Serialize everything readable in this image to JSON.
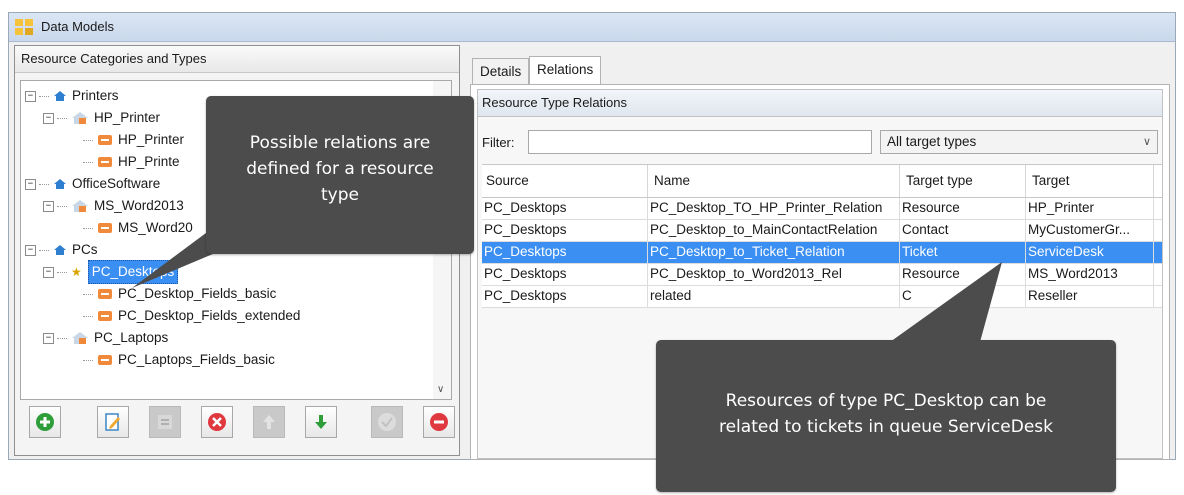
{
  "window": {
    "title": "Data Models"
  },
  "left_panel": {
    "title": "Resource Categories and Types",
    "tree": [
      {
        "label": "Printers"
      },
      {
        "label": "HP_Printer"
      },
      {
        "label": "HP_Printer"
      },
      {
        "label": "HP_Printe"
      },
      {
        "label": "OfficeSoftware"
      },
      {
        "label": "MS_Word2013"
      },
      {
        "label": "MS_Word20"
      },
      {
        "label": "PCs"
      },
      {
        "label": "PC_Desktops"
      },
      {
        "label": "PC_Desktop_Fields_basic"
      },
      {
        "label": "PC_Desktop_Fields_extended"
      },
      {
        "label": "PC_Laptops"
      },
      {
        "label": "PC_Laptops_Fields_basic"
      }
    ],
    "toolbar_icons": [
      "add-icon",
      "edit-icon",
      "edit-disabled-icon",
      "delete-icon",
      "move-up-icon",
      "move-down-icon",
      "confirm-icon",
      "remove-icon"
    ]
  },
  "right_panel": {
    "tabs": [
      "Details",
      "Relations"
    ],
    "active_tab": "Relations",
    "group_title": "Resource Type Relations",
    "filter_label": "Filter:",
    "filter_value": "",
    "target_filter": "All target types",
    "columns": [
      "Source",
      "Name",
      "Target type",
      "Target"
    ],
    "rows": [
      [
        "PC_Desktops",
        "PC_Desktop_TO_HP_Printer_Relation",
        "Resource",
        "HP_Printer"
      ],
      [
        "PC_Desktops",
        "PC_Desktop_to_MainContactRelation",
        "Contact",
        "MyCustomerGr..."
      ],
      [
        "PC_Desktops",
        "PC_Desktop_to_Ticket_Relation",
        "Ticket",
        "ServiceDesk"
      ],
      [
        "PC_Desktops",
        "PC_Desktop_to_Word2013_Rel",
        "Resource",
        "MS_Word2013"
      ],
      [
        "PC_Desktops",
        "related",
        "C",
        "Reseller"
      ]
    ],
    "selected_row": 2
  },
  "callouts": {
    "first": [
      "Possible relations are",
      "defined for a resource",
      "type"
    ],
    "second": [
      "Resources of type PC_Desktop can be",
      "related to tickets in queue ServiceDesk"
    ]
  },
  "colors": {
    "selection": "#3b8ff2",
    "callout": "#4c4c4c",
    "titlebar": "#c9d8ec"
  }
}
